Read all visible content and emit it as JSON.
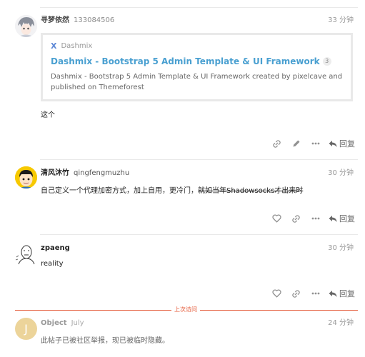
{
  "posts": [
    {
      "username": "寻梦依然",
      "handle": "133084506",
      "time": "33 分钟",
      "onebox": {
        "site": "Dashmix",
        "title": "Dashmix - Bootstrap 5 Admin Template & UI Framework",
        "count": "3",
        "description": "Dashmix - Bootstrap 5 Admin Template & UI Framework created by pixelcave and published on Themeforest"
      },
      "body": "这个",
      "reply_label": "回复"
    },
    {
      "username": "清风沐竹",
      "handle": "qingfengmuzhu",
      "time": "30 分钟",
      "body_plain": "自己定义一个代理加密方式，加上自用，更冷门，",
      "body_strike": "就如当年Shadowsocks才出来时",
      "reply_label": "回复"
    },
    {
      "username": "zpaeng",
      "handle": "",
      "time": "30 分钟",
      "body": "reality",
      "reply_label": "回复"
    },
    {
      "username": "Object",
      "handle": "July",
      "time": "24 分钟",
      "avatar_letter": "J",
      "body": "此帖子已被社区举报，现已被临时隐藏。"
    }
  ],
  "last_visit_label": "上次访问",
  "colors": {
    "link": "#4aa0d1",
    "last_visit": "#e45735",
    "avatar_j": "#ecd49a"
  }
}
